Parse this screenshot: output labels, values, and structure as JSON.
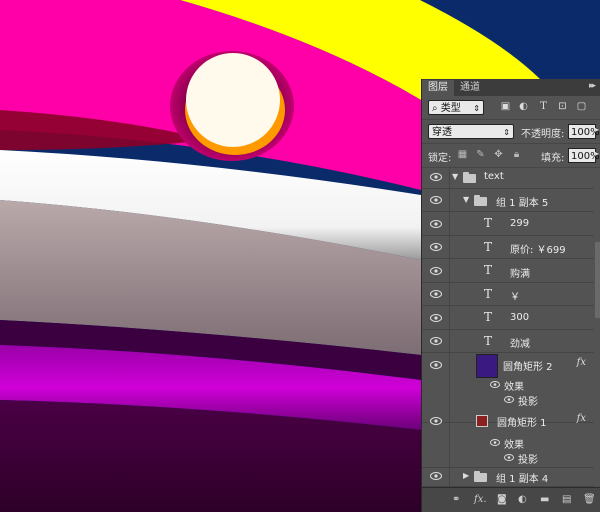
{
  "panel": {
    "tabs": [
      "图层",
      "通道"
    ],
    "filter_label": "类型",
    "blend_mode": "穿透",
    "opacity_label": "不透明度:",
    "opacity_value": "100%",
    "lock_label": "锁定:",
    "fill_label": "填充:",
    "fill_value": "100%"
  },
  "layers": [
    {
      "name": "text"
    },
    {
      "name": "组 1 副本 5"
    },
    {
      "name": "299"
    },
    {
      "name": "原价: ￥699"
    },
    {
      "name": "购满"
    },
    {
      "name": "￥"
    },
    {
      "name": "300"
    },
    {
      "name": "劲减"
    },
    {
      "name": "圆角矩形 2"
    },
    {
      "name": "效果"
    },
    {
      "name": "投影"
    },
    {
      "name": "圆角矩形 1"
    },
    {
      "name": "效果"
    },
    {
      "name": "投影"
    },
    {
      "name": "组 1 副本 4"
    }
  ],
  "colors": {
    "magenta": "#ff00a8",
    "yellow": "#ffff00",
    "navy": "#0a2a6a",
    "cream": "#fffaeb",
    "orange": "#ff9900",
    "panel": "#535353"
  }
}
